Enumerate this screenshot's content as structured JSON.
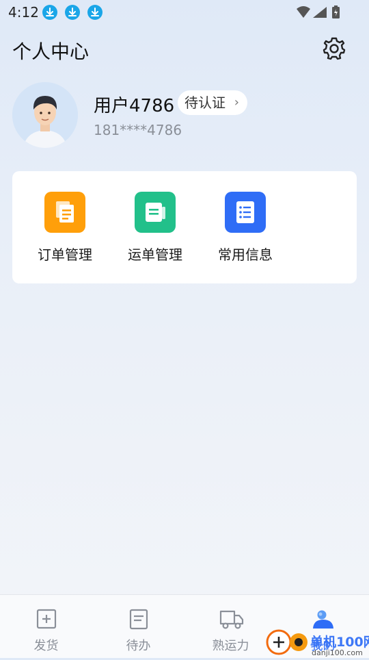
{
  "status_bar": {
    "time": "4:12"
  },
  "header": {
    "title": "个人中心"
  },
  "profile": {
    "username": "用户4786",
    "verify_label": "待认证",
    "verify_chevron": "›",
    "phone": "181****4786"
  },
  "quick_actions": [
    {
      "label": "订单管理",
      "color": "#ff9f0a",
      "icon": "order-icon"
    },
    {
      "label": "运单管理",
      "color": "#22c08a",
      "icon": "waybill-icon"
    },
    {
      "label": "常用信息",
      "color": "#2f6df6",
      "icon": "info-list-icon"
    }
  ],
  "tabbar": {
    "items": [
      {
        "label": "发货",
        "icon": "add-box-icon"
      },
      {
        "label": "待办",
        "icon": "todo-doc-icon"
      },
      {
        "label": "熟运力",
        "icon": "truck-icon"
      },
      {
        "label": "我的",
        "icon": "profile-icon",
        "active": true
      }
    ]
  },
  "watermark": {
    "text": "单机100网",
    "url_text": "danji100.com"
  },
  "colors": {
    "active_tab": "#2f6df6",
    "muted_text": "#8a8f98",
    "download_badge": "#1aa6e8"
  }
}
